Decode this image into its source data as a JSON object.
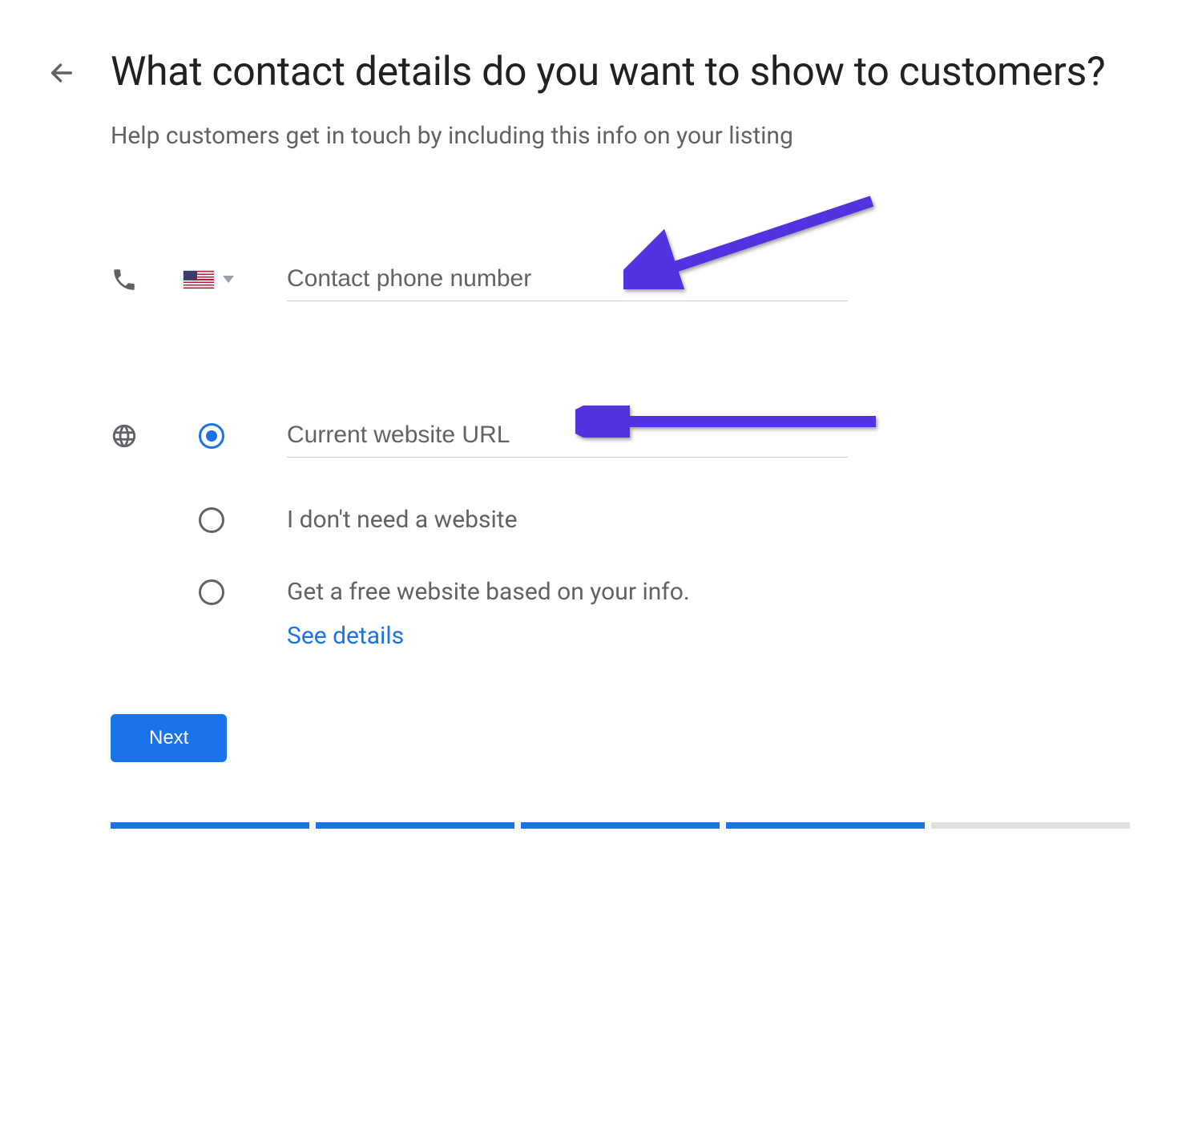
{
  "header": {
    "title": "What contact details do you want to show to customers?",
    "subtitle": "Help customers get in touch by including this info on your listing"
  },
  "phone_section": {
    "placeholder": "Contact phone number",
    "value": "",
    "country_flag": "us-flag"
  },
  "website_section": {
    "options": [
      {
        "placeholder": "Current website URL",
        "value": "",
        "selected": true,
        "type": "input"
      },
      {
        "label": "I don't need a website",
        "selected": false,
        "type": "label"
      },
      {
        "label": "Get a free website based on your info.",
        "selected": false,
        "type": "label"
      }
    ],
    "see_details_label": "See details"
  },
  "next_button_label": "Next",
  "progress": {
    "completed": 4,
    "total": 5
  },
  "colors": {
    "accent": "#1a73e8",
    "annotation": "#5333e0",
    "muted": "#5f6368"
  }
}
